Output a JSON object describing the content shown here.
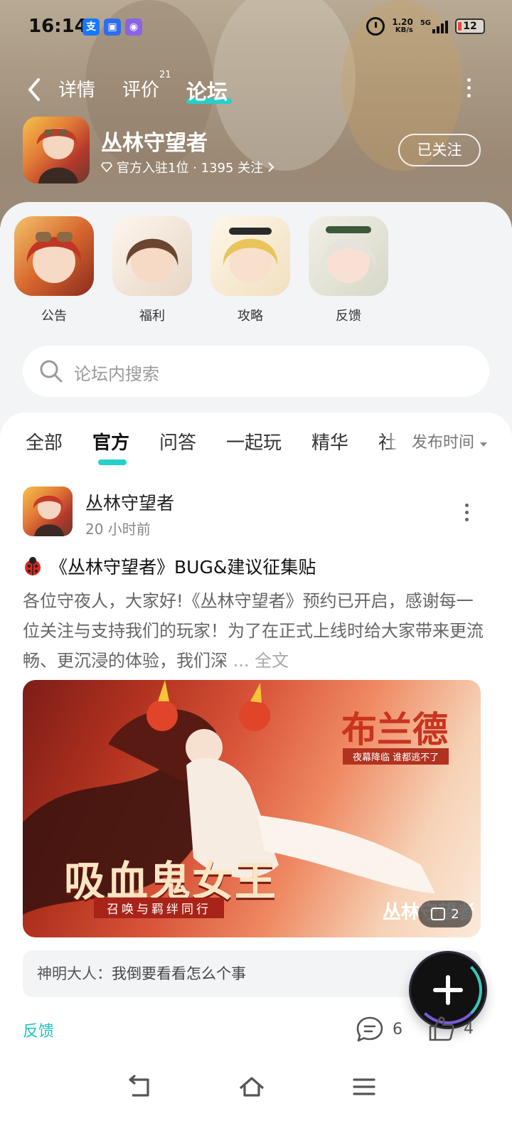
{
  "status_bar": {
    "time": "16:14",
    "app_icons": [
      "alipay-icon",
      "message-icon",
      "app-icon"
    ],
    "net_speed_value": "1.20",
    "net_speed_unit": "KB/s",
    "network": "5G",
    "battery": "12"
  },
  "nav": {
    "tabs": [
      {
        "label": "详情"
      },
      {
        "label": "评价",
        "badge": "21"
      },
      {
        "label": "论坛",
        "active": true
      }
    ]
  },
  "app": {
    "name": "丛林守望者",
    "meta": "官方入驻1位 · 1395 关注",
    "follow_label": "已关注"
  },
  "categories": [
    {
      "label": "公告"
    },
    {
      "label": "福利"
    },
    {
      "label": "攻略"
    },
    {
      "label": "反馈"
    }
  ],
  "search": {
    "placeholder": "论坛内搜索"
  },
  "filter_tabs": [
    "全部",
    "官方",
    "问答",
    "一起玩",
    "精华",
    "社"
  ],
  "sort_label": "发布时间",
  "post": {
    "author": "丛林守望者",
    "time": "20 小时前",
    "title": "《丛林守望者》BUG&建议征集贴",
    "body": "各位守夜人，大家好!《丛林守望者》预约已开启，感谢每一位关注与支持我们的玩家！为了在正式上线时给大家带来更流畅、更沉浸的体验，我们深",
    "more_label": "... 全文",
    "banner": {
      "title": "吸血鬼女王",
      "subtitle": "召唤与羁绊同行",
      "hero_name": "布兰德",
      "hero_tag": "夜幕降临 谁都逃不了",
      "brand": "丛林守望者",
      "image_count": "2"
    },
    "comment": {
      "user": "神明大人：",
      "text": "我倒要看看怎么个事"
    },
    "tag": "反馈",
    "comment_count": "6",
    "like_count": "4"
  },
  "colors": {
    "accent": "#24d0c8",
    "tag": "#20c5bc"
  }
}
